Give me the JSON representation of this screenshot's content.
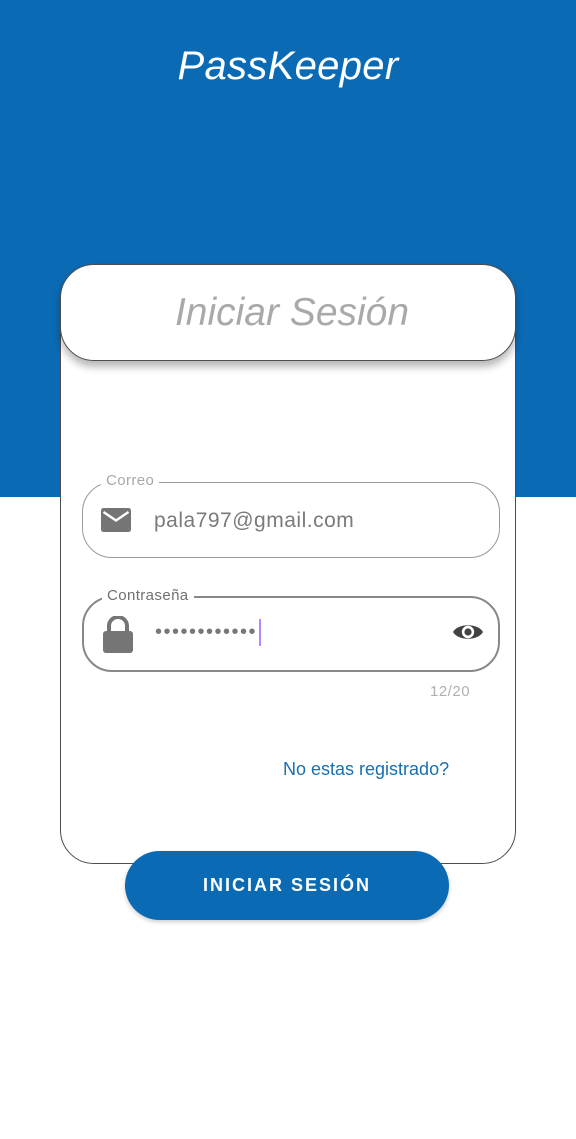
{
  "app": {
    "title": "PassKeeper"
  },
  "card": {
    "title": "Iniciar Sesión"
  },
  "email_field": {
    "label": "Correo",
    "value": "pala797@gmail.com",
    "icon": "email-icon"
  },
  "password_field": {
    "label": "Contraseña",
    "value_masked": "••••••••••••",
    "icon": "lock-icon",
    "toggle_icon": "eye-icon",
    "counter": "12/20"
  },
  "links": {
    "register": "No estas registrado?"
  },
  "actions": {
    "login_label": "INICIAR SESIÓN"
  },
  "colors": {
    "primary": "#0b6ab4",
    "link": "#1a6fae",
    "cursor": "#b388ff"
  }
}
